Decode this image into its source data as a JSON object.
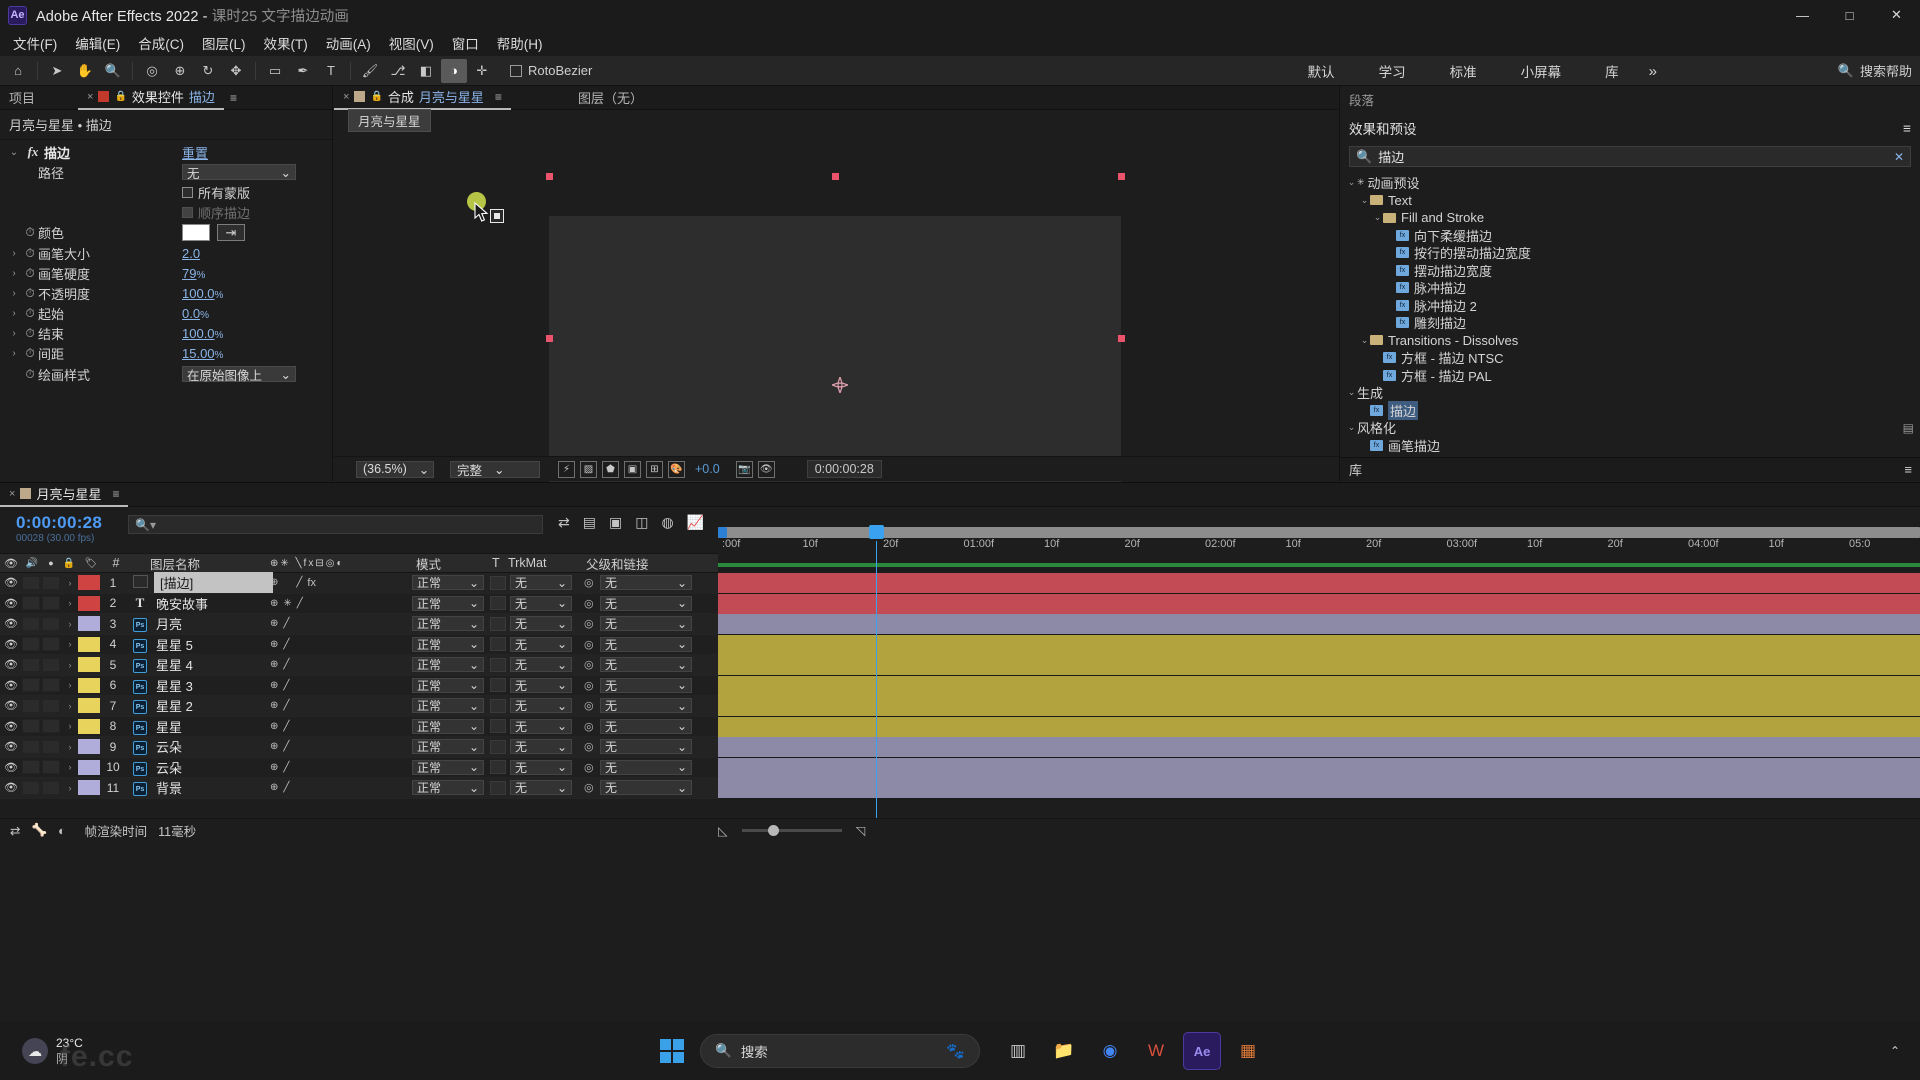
{
  "titlebar": {
    "app_title": "Adobe After Effects 2022 - ",
    "document_title": "课时25 文字描边动画",
    "logo": "Ae",
    "minimize": "—",
    "maximize": "□",
    "close": "✕"
  },
  "menubar": {
    "items": [
      {
        "label": "文件(F)"
      },
      {
        "label": "编辑(E)"
      },
      {
        "label": "合成(C)"
      },
      {
        "label": "图层(L)"
      },
      {
        "label": "效果(T)"
      },
      {
        "label": "动画(A)"
      },
      {
        "label": "视图(V)"
      },
      {
        "label": "窗口"
      },
      {
        "label": "帮助(H)"
      }
    ]
  },
  "toolbar": {
    "tools": [
      {
        "name": "home-icon",
        "glyph": "⌂"
      },
      {
        "name": "selection-tool",
        "glyph": "➤"
      },
      {
        "name": "hand-tool",
        "glyph": "✋"
      },
      {
        "name": "zoom-tool",
        "glyph": "🔍"
      },
      {
        "name": "orbit-tool",
        "glyph": "◎"
      },
      {
        "name": "pan-camera-tool",
        "glyph": "⊕"
      },
      {
        "name": "rotation-tool",
        "glyph": "↻"
      },
      {
        "name": "anchor-point-tool",
        "glyph": "✥"
      },
      {
        "name": "shape-tool",
        "glyph": "▭"
      },
      {
        "name": "pen-tool",
        "glyph": "✒"
      },
      {
        "name": "type-tool",
        "glyph": "T"
      },
      {
        "name": "brush-tool",
        "glyph": "🖌"
      },
      {
        "name": "clone-stamp-tool",
        "glyph": "⎇"
      },
      {
        "name": "eraser-tool",
        "glyph": "◧"
      },
      {
        "name": "roto-brush-tool",
        "glyph": "◑"
      },
      {
        "name": "puppet-pin-tool",
        "glyph": "✛"
      }
    ],
    "roto_label": "RotoBezier",
    "workspaces": [
      "默认",
      "学习",
      "标准",
      "小屏幕",
      "库"
    ],
    "workspace_more": "»",
    "help_search_label": "搜索帮助",
    "help_search_icon": "search-icon"
  },
  "effect_controls": {
    "tabs": [
      {
        "label": "项目",
        "active": false
      },
      {
        "label": "效果控件",
        "highlight": "描边",
        "active": true
      }
    ],
    "close_glyph": "×",
    "lock_glyph": "🔒",
    "menu_glyph": "≡",
    "breadcrumb": "月亮与星星 • 描边",
    "effect_name": "描边",
    "reset_label": "重置",
    "properties": [
      {
        "name": "路径",
        "type": "dropdown",
        "value": "无",
        "twirl": false,
        "stopwatch": false
      },
      {
        "name": "所有蒙版",
        "type": "checkbox",
        "checked": false,
        "twirl": false,
        "stopwatch": false
      },
      {
        "name": "顺序描边",
        "type": "checkbox",
        "checked": true,
        "disabled": true,
        "twirl": false,
        "stopwatch": false
      },
      {
        "name": "颜色",
        "type": "color",
        "value": "#ffffff",
        "twirl": false,
        "stopwatch": true
      },
      {
        "name": "画笔大小",
        "type": "number",
        "value": "2.0",
        "unit": "",
        "twirl": true,
        "stopwatch": true
      },
      {
        "name": "画笔硬度",
        "type": "number",
        "value": "79",
        "unit": "%",
        "twirl": true,
        "stopwatch": true
      },
      {
        "name": "不透明度",
        "type": "number",
        "value": "100.0",
        "unit": "%",
        "twirl": true,
        "stopwatch": true
      },
      {
        "name": "起始",
        "type": "number",
        "value": "0.0",
        "unit": "%",
        "twirl": true,
        "stopwatch": true
      },
      {
        "name": "结束",
        "type": "number",
        "value": "100.0",
        "unit": "%",
        "twirl": true,
        "stopwatch": true
      },
      {
        "name": "间距",
        "type": "number",
        "value": "15.00",
        "unit": "%",
        "twirl": true,
        "stopwatch": true
      },
      {
        "name": "绘画样式",
        "type": "dropdown",
        "value": "在原始图像上",
        "twirl": false,
        "stopwatch": true
      }
    ]
  },
  "composition": {
    "tabs": [
      {
        "label": "合成",
        "highlight": "月亮与星星",
        "active": true
      },
      {
        "label": "图层（无）",
        "active": false
      }
    ],
    "close_glyph": "×",
    "menu_glyph": "≡",
    "crumb_chip": "月亮与星星",
    "bottom": {
      "zoom": "(36.5%)",
      "resolution": "完整",
      "exposure": "+0.0",
      "timecode": "0:00:00:28",
      "icons": [
        {
          "name": "fast-previews-icon",
          "glyph": "⚡"
        },
        {
          "name": "transparency-grid-icon",
          "glyph": "▨"
        },
        {
          "name": "masks-icon",
          "glyph": "⬟"
        },
        {
          "name": "region-of-interest-icon",
          "glyph": "▣"
        },
        {
          "name": "grid-guides-icon",
          "glyph": "⊞"
        },
        {
          "name": "color-management-icon",
          "glyph": "🎨"
        },
        {
          "name": "snapshot-icon",
          "glyph": "📷"
        },
        {
          "name": "show-snapshot-icon",
          "glyph": "👁"
        }
      ]
    }
  },
  "effects_presets": {
    "top_label": "段落",
    "panel_title": "效果和预设",
    "menu_glyph": "≡",
    "search_value": "描边",
    "search_icon": "search-icon",
    "clear_glyph": "✕",
    "tree": [
      {
        "depth": 0,
        "label": "动画预设",
        "type": "group",
        "twirl": "⌄",
        "star": true
      },
      {
        "depth": 1,
        "label": "Text",
        "type": "folder",
        "twirl": "⌄"
      },
      {
        "depth": 2,
        "label": "Fill and Stroke",
        "type": "folder",
        "twirl": "⌄"
      },
      {
        "depth": 3,
        "label": "向下柔缓描边",
        "type": "preset"
      },
      {
        "depth": 3,
        "label": "按行的摆动描边宽度",
        "type": "preset"
      },
      {
        "depth": 3,
        "label": "摆动描边宽度",
        "type": "preset"
      },
      {
        "depth": 3,
        "label": "脉冲描边",
        "type": "preset"
      },
      {
        "depth": 3,
        "label": "脉冲描边 2",
        "type": "preset"
      },
      {
        "depth": 3,
        "label": "雕刻描边",
        "type": "preset"
      },
      {
        "depth": 1,
        "label": "Transitions - Dissolves",
        "type": "folder",
        "twirl": "⌄"
      },
      {
        "depth": 2,
        "label": "方框 - 描边 NTSC",
        "type": "preset"
      },
      {
        "depth": 2,
        "label": "方框 - 描边 PAL",
        "type": "preset"
      },
      {
        "depth": 0,
        "label": "生成",
        "type": "group",
        "twirl": "⌄"
      },
      {
        "depth": 1,
        "label": "描边",
        "type": "effect",
        "selected": true
      },
      {
        "depth": 0,
        "label": "风格化",
        "type": "group",
        "twirl": "⌄"
      },
      {
        "depth": 1,
        "label": "画笔描边",
        "type": "effect"
      }
    ],
    "library_label": "库",
    "library_menu_glyph": "≡"
  },
  "timeline": {
    "tabs": [
      {
        "label": "月亮与星星",
        "active": true
      }
    ],
    "close_glyph": "×",
    "menu_glyph": "≡",
    "current_time": "0:00:00:28",
    "current_time_sub": "00028 (30.00 fps)",
    "search_placeholder": "",
    "search_icon": "search-icon",
    "header_icons": [
      {
        "name": "composition-mini-flowchart-icon",
        "glyph": "⇄"
      },
      {
        "name": "draft-3d-icon",
        "glyph": "▤"
      },
      {
        "name": "hide-shy-layers-icon",
        "glyph": "▣"
      },
      {
        "name": "frame-blending-icon",
        "glyph": "◫"
      },
      {
        "name": "motion-blur-icon",
        "glyph": "◍"
      },
      {
        "name": "graph-editor-icon",
        "glyph": "📈"
      }
    ],
    "columns": [
      {
        "name": "video-icon",
        "label": "👁"
      },
      {
        "name": "audio-icon",
        "label": "🔊"
      },
      {
        "name": "solo-icon",
        "label": "●"
      },
      {
        "name": "lock-icon",
        "label": "🔒"
      },
      {
        "name": "label-icon",
        "label": "🏷"
      },
      {
        "name": "index",
        "label": "#"
      },
      {
        "name": "layer-name",
        "label": "图层名称"
      },
      {
        "name": "switches",
        "label": "⊕✳ ╲fx⊟◎◐"
      },
      {
        "name": "mode",
        "label": "模式"
      },
      {
        "name": "track-matte-t",
        "label": "T"
      },
      {
        "name": "track-matte",
        "label": "TrkMat"
      },
      {
        "name": "parent-and-link",
        "label": "父级和链接"
      }
    ],
    "ruler_labels": [
      ":00f",
      "10f",
      "20f",
      "01:00f",
      "10f",
      "20f",
      "02:00f",
      "10f",
      "20f",
      "03:00f",
      "10f",
      "20f",
      "04:00f",
      "10f",
      "05:0"
    ],
    "mode_default": "正常",
    "trkmat_default": "无",
    "parent_default": "无",
    "layers": [
      {
        "index": "1",
        "name": "[描边]",
        "color": "#cf4343",
        "type": "solid",
        "selected": true,
        "bar_color": "#c24b55",
        "has_fx": true
      },
      {
        "index": "2",
        "name": "晚安故事",
        "color": "#cf4343",
        "type": "text",
        "selected": false,
        "bar_color": "#c24b55",
        "has_fx": false
      },
      {
        "index": "3",
        "name": "月亮",
        "color": "#b0addb",
        "type": "ps",
        "selected": false,
        "bar_color": "#8d8aa8",
        "has_fx": false
      },
      {
        "index": "4",
        "name": "星星 5",
        "color": "#e8d45c",
        "type": "ps",
        "selected": false,
        "bar_color": "#b3a33f",
        "has_fx": false
      },
      {
        "index": "5",
        "name": "星星 4",
        "color": "#e8d45c",
        "type": "ps",
        "selected": false,
        "bar_color": "#b3a33f",
        "has_fx": false
      },
      {
        "index": "6",
        "name": "星星 3",
        "color": "#e8d45c",
        "type": "ps",
        "selected": false,
        "bar_color": "#b3a33f",
        "has_fx": false
      },
      {
        "index": "7",
        "name": "星星 2",
        "color": "#e8d45c",
        "type": "ps",
        "selected": false,
        "bar_color": "#b3a33f",
        "has_fx": false
      },
      {
        "index": "8",
        "name": "星星",
        "color": "#e8d45c",
        "type": "ps",
        "selected": false,
        "bar_color": "#b3a33f",
        "has_fx": false
      },
      {
        "index": "9",
        "name": "云朵",
        "color": "#b0addb",
        "type": "ps",
        "selected": false,
        "bar_color": "#8d8aa8",
        "has_fx": false
      },
      {
        "index": "10",
        "name": "云朵",
        "color": "#b0addb",
        "type": "ps",
        "selected": false,
        "bar_color": "#8d8aa8",
        "has_fx": false
      },
      {
        "index": "11",
        "name": "背景",
        "color": "#b0addb",
        "type": "ps",
        "selected": false,
        "bar_color": "#8d8aa8",
        "has_fx": false
      }
    ],
    "footer": {
      "render_time_label": "帧渲染时间",
      "render_time_value": "11毫秒",
      "icons": [
        {
          "name": "toggle-switches-modes-icon",
          "glyph": "⇄"
        },
        {
          "name": "bone-icon",
          "glyph": "🦴"
        },
        {
          "name": "mask-icon",
          "glyph": "◐"
        }
      ]
    }
  },
  "taskbar": {
    "weather_temp": "23°C",
    "weather_desc": "阴",
    "weather_icon": "cloud-icon",
    "search_placeholder": "搜索",
    "start_icon": "windows-logo-icon",
    "apps": [
      {
        "name": "task-view-icon",
        "glyph": "▥",
        "color": "#c8c8c8"
      },
      {
        "name": "file-explorer-icon",
        "glyph": "📁",
        "color": "#e8b64c"
      },
      {
        "name": "chrome-icon",
        "glyph": "◉",
        "color": "#4285f4"
      },
      {
        "name": "wps-icon",
        "glyph": "W",
        "color": "#d94f3d"
      },
      {
        "name": "after-effects-icon",
        "glyph": "Ae",
        "color": "#9b8cf0"
      },
      {
        "name": "app-icon",
        "glyph": "▦",
        "color": "#e07b39"
      }
    ],
    "tray_glyph": "⌃",
    "watermark": "fe.cc"
  }
}
